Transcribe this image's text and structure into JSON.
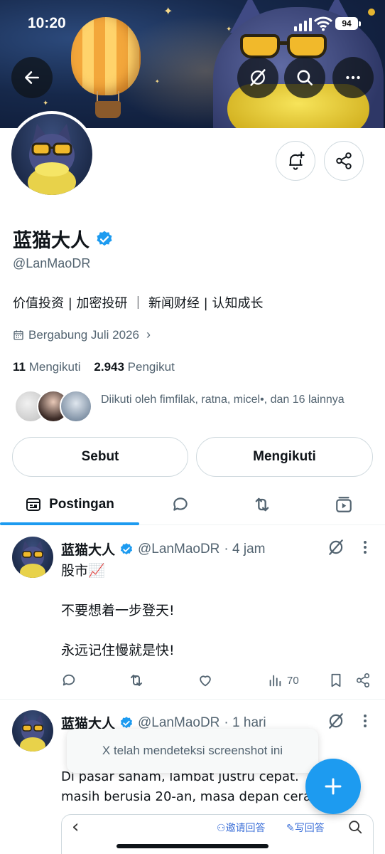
{
  "status_bar": {
    "time": "10:20",
    "battery": "94"
  },
  "profile": {
    "name": "蓝猫大人",
    "handle": "@LanMaoDR",
    "bio": "价值投资 | 加密投研 ｜ 新闻财经 | 认知成长",
    "joined": "Bergabung Juli 2026",
    "following_count": "11",
    "following_label": "Mengikuti",
    "followers_count": "2.943",
    "followers_label": "Pengikut",
    "followed_by": "Diikuti oleh fimfilak, ratna, micel•, dan 16 lainnya"
  },
  "buttons": {
    "mention": "Sebut",
    "following": "Mengikuti"
  },
  "tabs": [
    {
      "label": "Postingan",
      "icon": "posts-icon"
    },
    {
      "icon": "reply-icon"
    },
    {
      "icon": "repost-icon"
    },
    {
      "icon": "media-icon"
    }
  ],
  "tweets": [
    {
      "name": "蓝猫大人",
      "handle": "@LanMaoDR",
      "time": "· 4 jam",
      "text": "股市📈\n\n不要想着一步登天!\n\n永远记住慢就是快!",
      "views": "70"
    },
    {
      "name": "蓝猫大人",
      "handle": "@LanMaoDR",
      "time": "· 1 hari",
      "text": "Di pasar saham, lambat justru cepat.\nmasih berusia 20-an, masa depan cerah"
    }
  ],
  "toast": "X telah mendeteksi screenshot ini",
  "quote_bar": {
    "invite": "邀请回答",
    "write": "写回答"
  },
  "colors": {
    "accent": "#1d9bf0",
    "text": "#0f1419",
    "muted": "#536471"
  }
}
